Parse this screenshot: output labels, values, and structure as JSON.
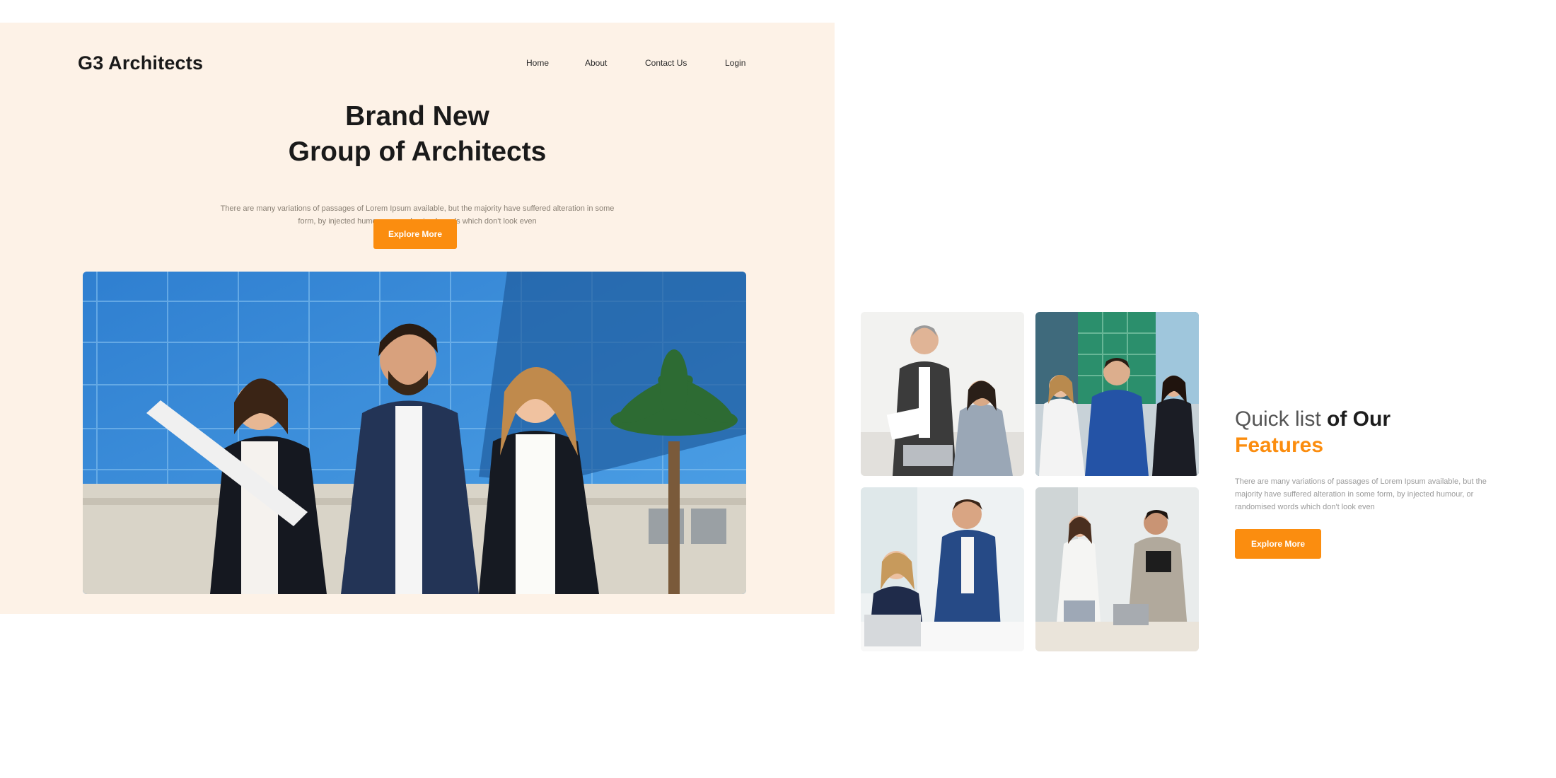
{
  "header": {
    "brand": "G3 Architects",
    "nav": [
      {
        "label": "Home"
      },
      {
        "label": "About"
      },
      {
        "label": "Contact Us"
      },
      {
        "label": "Login"
      }
    ]
  },
  "hero": {
    "title_line1": "Brand New",
    "title_line2": "Group of Architects",
    "description": "There are many variations of passages of Lorem Ipsum available, but the majority have suffered alteration in some form, by injected humour, or randomised words which don't look even",
    "cta_label": "Explore More"
  },
  "features": {
    "title_light": "Quick list",
    "title_bold": "of Our",
    "title_accent": "Features",
    "description": "There are many variations of passages of Lorem Ipsum available, but the majority have suffered alteration in some form, by injected humour, or randomised words which don't look even",
    "cta_label": "Explore More"
  },
  "colors": {
    "accent": "#fb8d0f",
    "hero_background": "#fdf2e7",
    "text_dark": "#1a1a1a"
  }
}
